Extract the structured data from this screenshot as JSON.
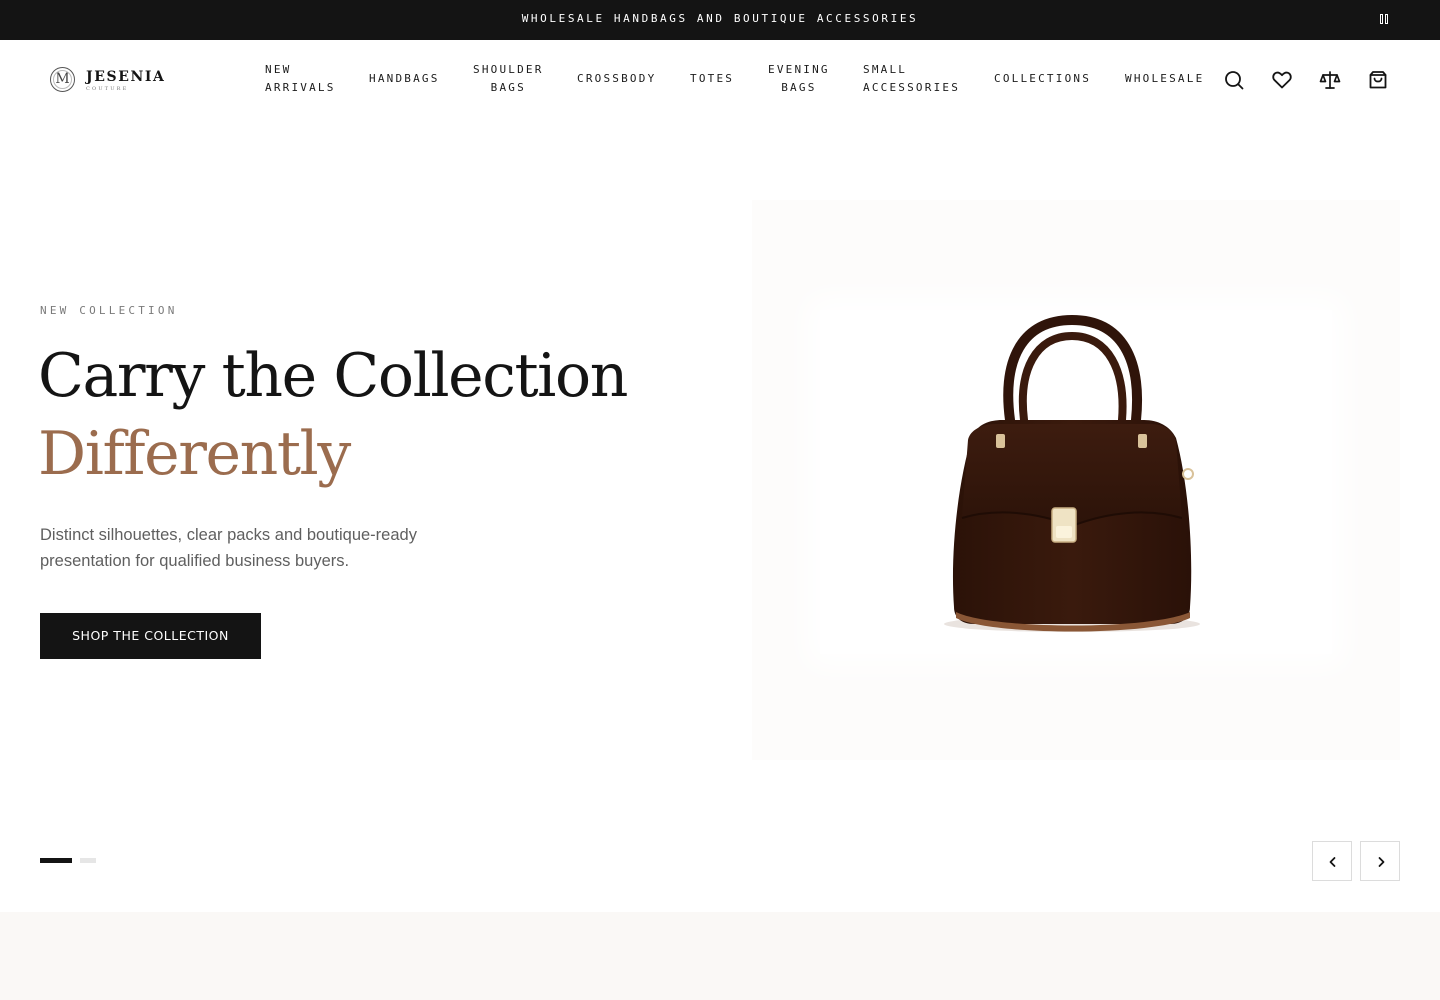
{
  "announcement": {
    "text": "WHOLESALE HANDBAGS AND BOUTIQUE ACCESSORIES",
    "pause_icon": "pause-icon"
  },
  "brand": {
    "monogram": "M",
    "name": "JESENIA",
    "tagline": "COUTURE"
  },
  "nav": {
    "new_arrivals": [
      "NEW",
      "ARRIVALS"
    ],
    "handbags": "HANDBAGS",
    "shoulder_bags": [
      "SHOULDER",
      "BAGS"
    ],
    "crossbody": "CROSSBODY",
    "totes": "TOTES",
    "evening_bags": [
      "EVENING",
      "BAGS"
    ],
    "small_accessories": [
      "SMALL",
      "ACCESSORIES"
    ],
    "collections": "COLLECTIONS",
    "wholesale": "WHOLESALE"
  },
  "header_icons": [
    "search-icon",
    "heart-icon",
    "compare-scale-icon",
    "shopping-bag-icon"
  ],
  "hero": {
    "eyebrow": "NEW COLLECTION",
    "title_line1": "Carry the Collection",
    "title_line2": "Differently",
    "description": "Distinct silhouettes, clear packs and boutique-ready presentation for qualified business buyers.",
    "cta_label": "SHOP THE COLLECTION",
    "accent_color": "#9b6c4e",
    "product_image": "dark brown leather top-handle satchel bag"
  },
  "slider": {
    "slide_count": 2,
    "active_index": 0,
    "prev_icon": "chevron-left-icon",
    "next_icon": "chevron-right-icon"
  },
  "colors": {
    "primary_dark": "#141414",
    "accent": "#9b6c4e",
    "muted_text": "#5f5f5f"
  }
}
